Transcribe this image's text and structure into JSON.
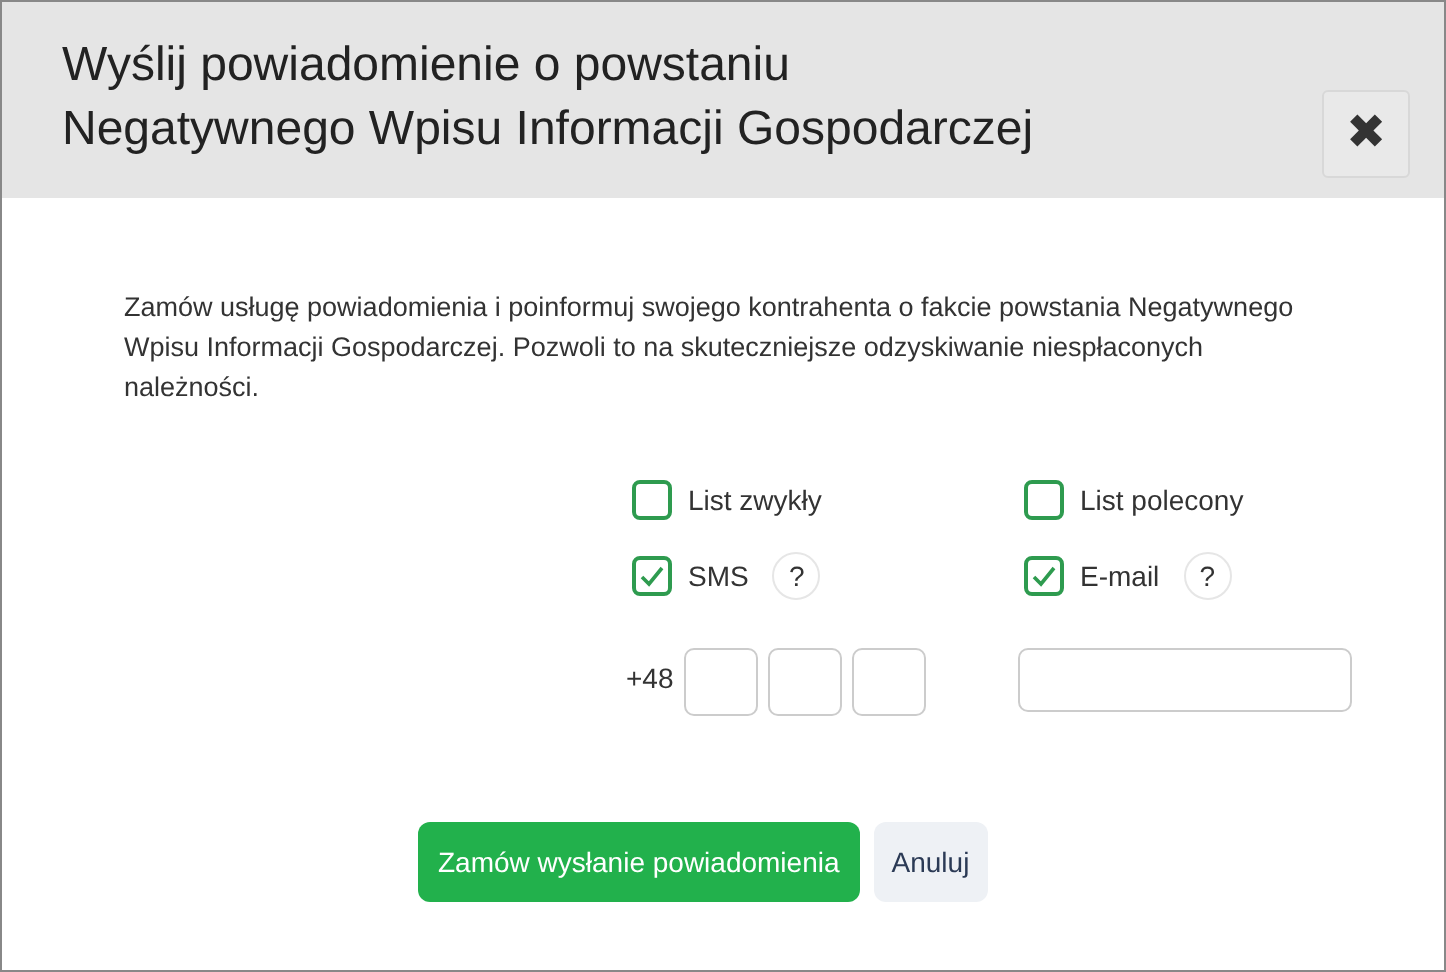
{
  "dialog": {
    "title_lines": [
      "Wyślij powiadomienie o powstaniu",
      "Negatywnego Wpisu Informacji Gospodarczej"
    ],
    "close": "✖"
  },
  "description": "Zamów usługę powiadomienia i poinformuj swojego kontrahenta o fakcie powstania Negatywnego Wpisu Informacji Gospodarczej. Pozwoli to na skuteczniejsze odzyskiwanie niespłaconych należności.",
  "options": [
    {
      "label": "List zwykły",
      "checked": false
    },
    {
      "label": "List polecony",
      "checked": false
    },
    {
      "label": "SMS",
      "checked": true,
      "help": "?"
    },
    {
      "label": "E-mail",
      "checked": true,
      "help": "?"
    }
  ],
  "phone": {
    "prefix": "+48"
  },
  "buttons": [
    {
      "label": "Zamów wysłanie powiadomienia",
      "kind": "primary"
    },
    {
      "label": "Anuluj",
      "kind": "secondary"
    }
  ]
}
